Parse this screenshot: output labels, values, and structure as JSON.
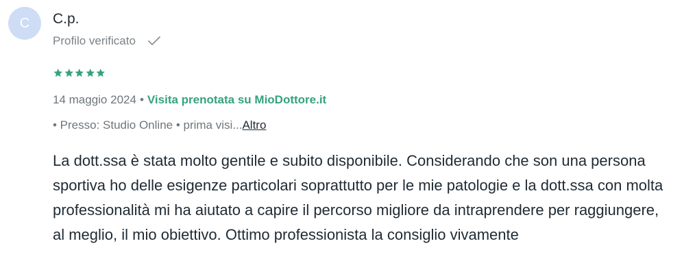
{
  "author": {
    "initial": "C",
    "name": "C.p.",
    "verified_label": "Profilo verificato"
  },
  "rating": {
    "value": 5,
    "max": 5,
    "star_color": "#35a37c"
  },
  "meta": {
    "date": "14 maggio 2024",
    "separator": "•",
    "booking_note": "Visita prenotata su MioDottore.it"
  },
  "place": {
    "text": "• Presso: Studio Online • prima visi...",
    "more_label": "Altro"
  },
  "review_text": "La dott.ssa è stata molto gentile e subito disponibile. Considerando che son una persona sportiva ho delle esigenze particolari soprattutto per le mie patologie e la dott.ssa con molta professionalità mi ha aiutato a capire il percorso migliore da intraprendere per raggiungere, al meglio, il mio obiettivo. Ottimo professionista la consiglio vivamente",
  "colors": {
    "accent": "#35a37c",
    "avatar_bg": "#cfdcf5",
    "muted_text": "#6e767b"
  }
}
